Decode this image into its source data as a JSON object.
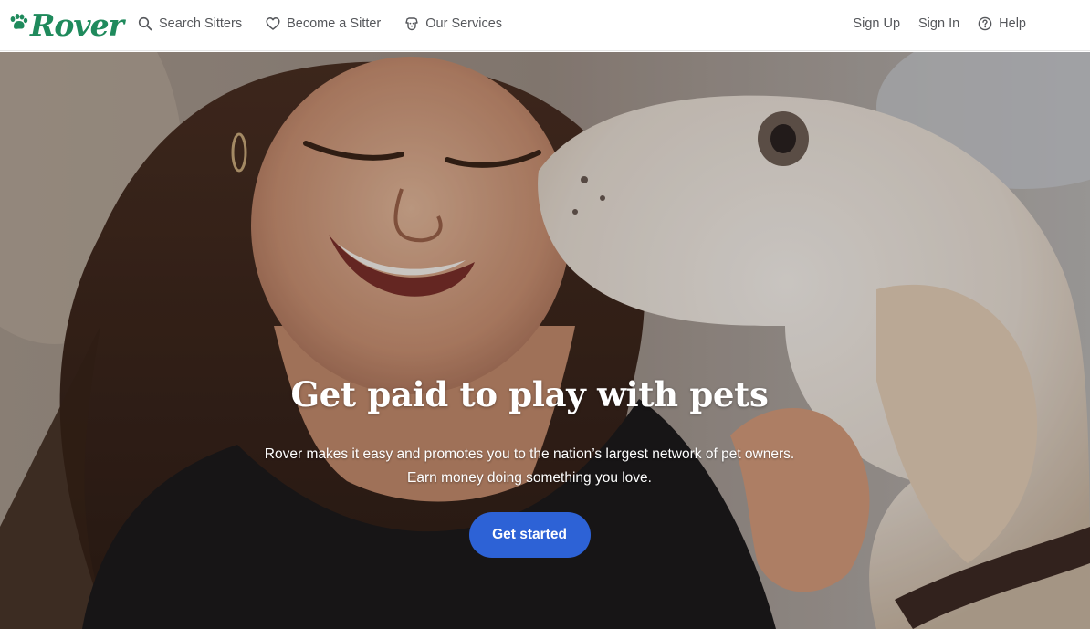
{
  "brand": {
    "logo_text": "Rover",
    "logo_icon": "paw-icon",
    "color": "#1f8a5c"
  },
  "nav": {
    "left": [
      {
        "label": "Search Sitters",
        "icon": "search-icon"
      },
      {
        "label": "Become a Sitter",
        "icon": "heart-icon"
      },
      {
        "label": "Our Services",
        "icon": "dog-face-icon"
      }
    ],
    "right": [
      {
        "label": "Sign Up"
      },
      {
        "label": "Sign In"
      },
      {
        "label": "Help",
        "icon": "help-circle-icon"
      }
    ]
  },
  "hero": {
    "title": "Get paid to play with pets",
    "subtitle_line1": "Rover makes it easy and promotes you to the nation’s largest network of pet owners.",
    "subtitle_line2": "Earn money doing something you love.",
    "cta_label": "Get started",
    "cta_color": "#2d62d6"
  }
}
